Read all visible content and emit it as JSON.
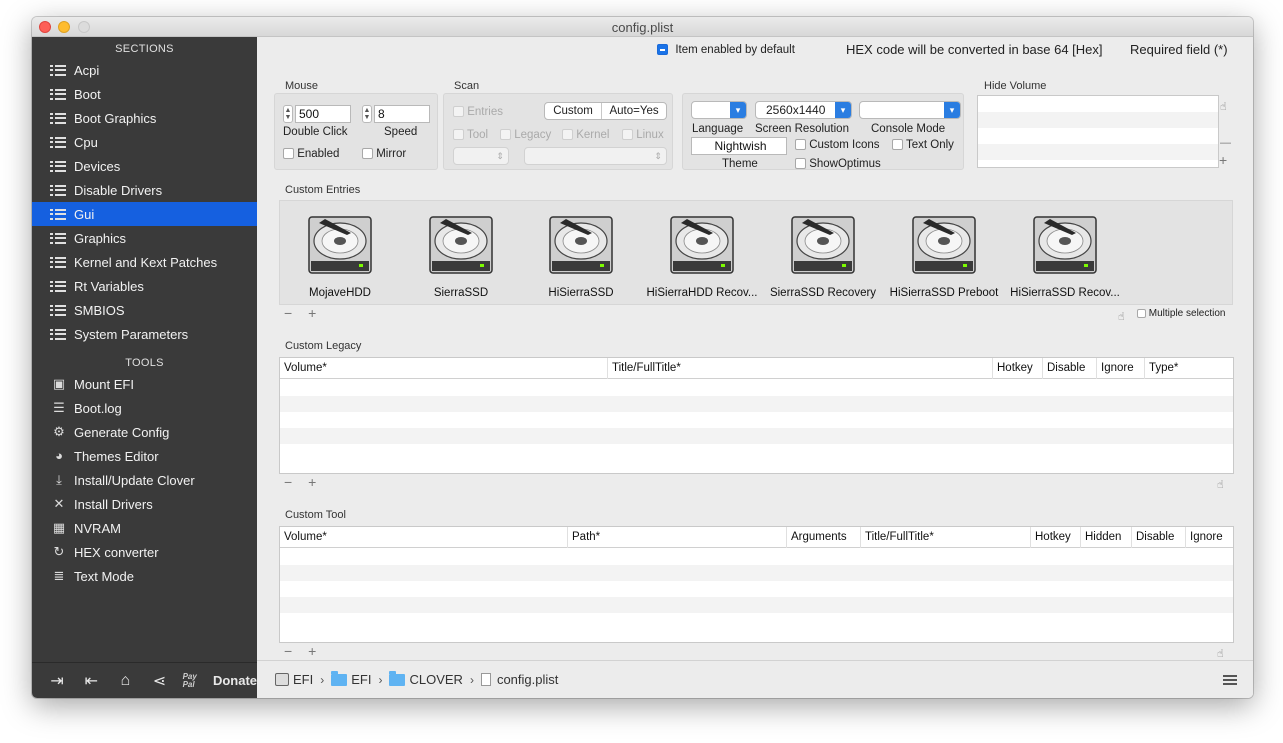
{
  "window": {
    "title": "config.plist"
  },
  "sidebar": {
    "sections_header": "SECTIONS",
    "sections": [
      {
        "label": "Acpi",
        "icon": "list-icon"
      },
      {
        "label": "Boot",
        "icon": "list-icon"
      },
      {
        "label": "Boot Graphics",
        "icon": "list-icon"
      },
      {
        "label": "Cpu",
        "icon": "list-icon"
      },
      {
        "label": "Devices",
        "icon": "list-icon"
      },
      {
        "label": "Disable Drivers",
        "icon": "list-icon"
      },
      {
        "label": "Gui",
        "icon": "list-icon",
        "active": true
      },
      {
        "label": "Graphics",
        "icon": "list-icon"
      },
      {
        "label": "Kernel and Kext Patches",
        "icon": "list-icon"
      },
      {
        "label": "Rt Variables",
        "icon": "list-icon"
      },
      {
        "label": "SMBIOS",
        "icon": "list-icon"
      },
      {
        "label": "System Parameters",
        "icon": "list-icon"
      }
    ],
    "tools_header": "TOOLS",
    "tools": [
      {
        "label": "Mount EFI",
        "icon": "mount-efi-icon"
      },
      {
        "label": "Boot.log",
        "icon": "boot-log-icon"
      },
      {
        "label": "Generate Config",
        "icon": "gears-icon"
      },
      {
        "label": "Themes Editor",
        "icon": "palette-icon"
      },
      {
        "label": "Install/Update Clover",
        "icon": "download-icon"
      },
      {
        "label": "Install Drivers",
        "icon": "tools-icon"
      },
      {
        "label": "NVRAM",
        "icon": "chip-icon"
      },
      {
        "label": "HEX converter",
        "icon": "refresh-icon"
      },
      {
        "label": "Text Mode",
        "icon": "text-mode-icon"
      }
    ],
    "footer": {
      "donate_label": "Donate",
      "paypal_mark": "Pay Pal"
    }
  },
  "header": {
    "item_enabled_default": "Item enabled by default",
    "hex_note": "HEX code will be converted in base 64 [Hex]",
    "required_field": "Required field (*)"
  },
  "mouse": {
    "group_label": "Mouse",
    "double_click_value": "500",
    "double_click_label": "Double Click",
    "speed_value": "8",
    "speed_label": "Speed",
    "enabled_label": "Enabled",
    "mirror_label": "Mirror"
  },
  "scan": {
    "group_label": "Scan",
    "entries_label": "Entries",
    "custom_label": "Custom",
    "auto_label": "Auto=Yes",
    "tool_label": "Tool",
    "legacy_label": "Legacy",
    "kernel_label": "Kernel",
    "linux_label": "Linux"
  },
  "display": {
    "language_label": "Language",
    "screen_resolution_value": "2560x1440",
    "screen_resolution_label": "Screen Resolution",
    "console_mode_label": "Console Mode",
    "theme_value": "Nightwish",
    "theme_label": "Theme",
    "custom_icons_label": "Custom Icons",
    "text_only_label": "Text Only",
    "show_optimus_label": "ShowOptimus"
  },
  "hide_volume": {
    "group_label": "Hide Volume"
  },
  "custom_entries": {
    "group_label": "Custom Entries",
    "multiple_selection_label": "Multiple selection",
    "disks": [
      "MojaveHDD",
      "SierraSSD",
      "HiSierraSSD",
      "HiSierraHDD Recov...",
      "SierraSSD Recovery",
      "HiSierraSSD Preboot",
      "HiSierraSSD Recov..."
    ]
  },
  "custom_legacy": {
    "group_label": "Custom Legacy",
    "columns": [
      "Volume*",
      "Title/FullTitle*",
      "Hotkey",
      "Disable",
      "Ignore",
      "Type*"
    ]
  },
  "custom_tool": {
    "group_label": "Custom Tool",
    "columns": [
      "Volume*",
      "Path*",
      "Arguments",
      "Title/FullTitle*",
      "Hotkey",
      "Hidden",
      "Disable",
      "Ignore"
    ]
  },
  "pathbar": {
    "crumbs": [
      "EFI",
      "EFI",
      "CLOVER",
      "config.plist"
    ]
  },
  "colors": {
    "accent": "#1560e0",
    "sidebar_bg": "#3a3a3a",
    "window_bg": "#ececec"
  }
}
